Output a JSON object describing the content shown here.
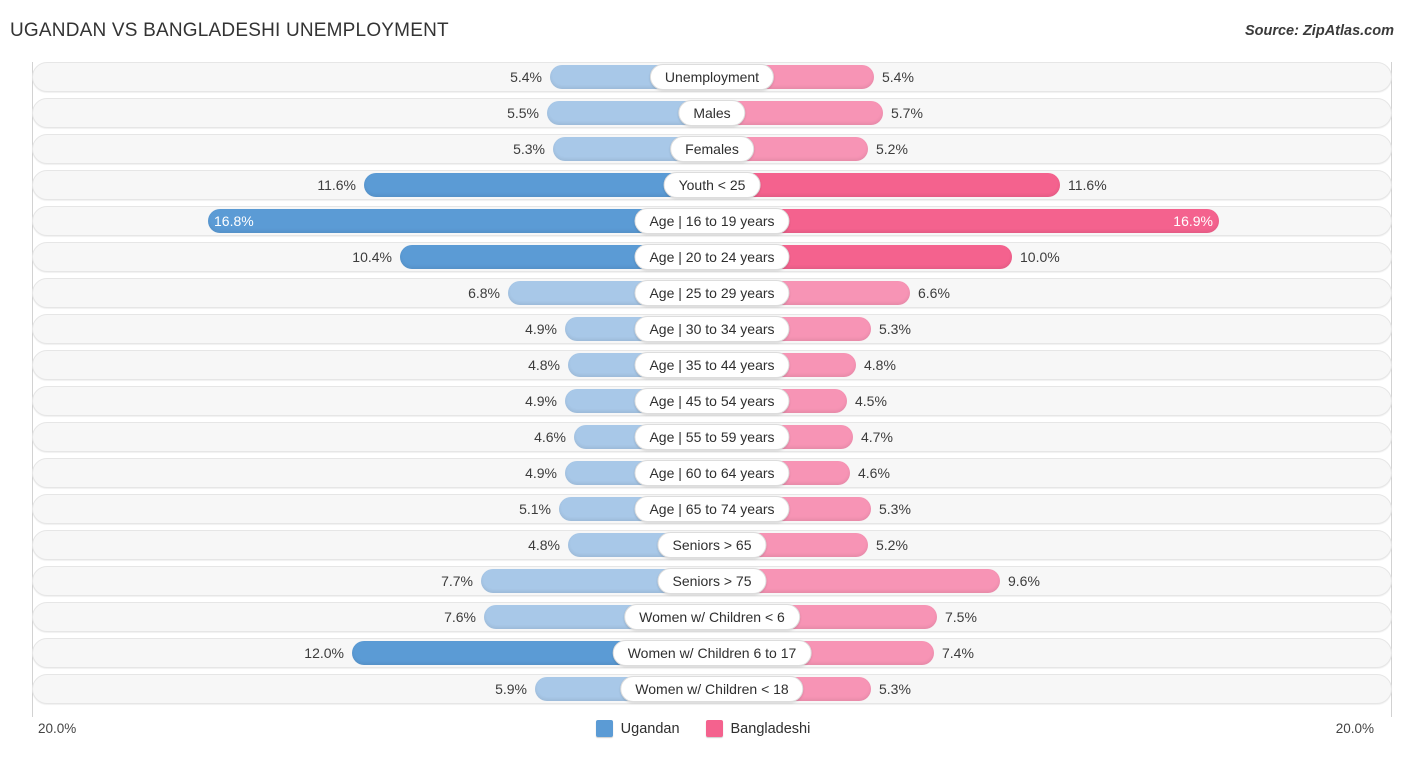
{
  "header": {
    "title": "UGANDAN VS BANGLADESHI UNEMPLOYMENT",
    "source": "Source: ZipAtlas.com"
  },
  "footer": {
    "axis_min_label": "20.0%",
    "axis_max_label": "20.0%",
    "legend": [
      {
        "label": "Ugandan",
        "color": "#5b9bd5"
      },
      {
        "label": "Bangladeshi",
        "color": "#f4628e"
      }
    ]
  },
  "colors": {
    "left_normal": "#a8c8e8",
    "left_highlight": "#5b9bd5",
    "right_normal": "#f794b5",
    "right_highlight": "#f4628e",
    "track": "#f7f7f7",
    "axis": "#d2d2d2"
  },
  "chart_data": {
    "type": "bar",
    "title": "UGANDAN VS BANGLADESHI UNEMPLOYMENT",
    "subtitle": "Source: ZipAtlas.com",
    "orientation": "horizontal-diverging",
    "xlabel": "",
    "ylabel": "",
    "axis_max": 20.0,
    "axis_unit": "%",
    "xlim": [
      20.0,
      20.0
    ],
    "grid": false,
    "legend_position": "bottom-center",
    "categories": [
      "Unemployment",
      "Males",
      "Females",
      "Youth < 25",
      "Age | 16 to 19 years",
      "Age | 20 to 24 years",
      "Age | 25 to 29 years",
      "Age | 30 to 34 years",
      "Age | 35 to 44 years",
      "Age | 45 to 54 years",
      "Age | 55 to 59 years",
      "Age | 60 to 64 years",
      "Age | 65 to 74 years",
      "Seniors > 65",
      "Seniors > 75",
      "Women w/ Children < 6",
      "Women w/ Children 6 to 17",
      "Women w/ Children < 18"
    ],
    "series": [
      {
        "name": "Ugandan",
        "color": "#5b9bd5",
        "values": [
          5.4,
          5.5,
          5.3,
          11.6,
          16.8,
          10.4,
          6.8,
          4.9,
          4.8,
          4.9,
          4.6,
          4.9,
          5.1,
          4.8,
          7.7,
          7.6,
          12.0,
          5.9
        ],
        "labels": [
          "5.4%",
          "5.5%",
          "5.3%",
          "11.6%",
          "16.8%",
          "10.4%",
          "6.8%",
          "4.9%",
          "4.8%",
          "4.9%",
          "4.6%",
          "4.9%",
          "5.1%",
          "4.8%",
          "7.7%",
          "7.6%",
          "12.0%",
          "5.9%"
        ]
      },
      {
        "name": "Bangladeshi",
        "color": "#f4628e",
        "values": [
          5.4,
          5.7,
          5.2,
          11.6,
          16.9,
          10.0,
          6.6,
          5.3,
          4.8,
          4.5,
          4.7,
          4.6,
          5.3,
          5.2,
          9.6,
          7.5,
          7.4,
          5.3
        ],
        "labels": [
          "5.4%",
          "5.7%",
          "5.2%",
          "11.6%",
          "16.9%",
          "10.0%",
          "6.6%",
          "5.3%",
          "4.8%",
          "4.5%",
          "4.7%",
          "4.6%",
          "5.3%",
          "5.2%",
          "9.6%",
          "7.5%",
          "7.4%",
          "5.3%"
        ]
      }
    ]
  },
  "rows": [
    {
      "label": "Unemployment",
      "left": 5.4,
      "left_label": "5.4%",
      "right": 5.4,
      "right_label": "5.4%",
      "left_hl": false,
      "right_hl": false
    },
    {
      "label": "Males",
      "left": 5.5,
      "left_label": "5.5%",
      "right": 5.7,
      "right_label": "5.7%",
      "left_hl": false,
      "right_hl": false
    },
    {
      "label": "Females",
      "left": 5.3,
      "left_label": "5.3%",
      "right": 5.2,
      "right_label": "5.2%",
      "left_hl": false,
      "right_hl": false
    },
    {
      "label": "Youth < 25",
      "left": 11.6,
      "left_label": "11.6%",
      "right": 11.6,
      "right_label": "11.6%",
      "left_hl": true,
      "right_hl": true
    },
    {
      "label": "Age | 16 to 19 years",
      "left": 16.8,
      "left_label": "16.8%",
      "right": 16.9,
      "right_label": "16.9%",
      "left_hl": true,
      "right_hl": true
    },
    {
      "label": "Age | 20 to 24 years",
      "left": 10.4,
      "left_label": "10.4%",
      "right": 10.0,
      "right_label": "10.0%",
      "left_hl": true,
      "right_hl": true
    },
    {
      "label": "Age | 25 to 29 years",
      "left": 6.8,
      "left_label": "6.8%",
      "right": 6.6,
      "right_label": "6.6%",
      "left_hl": false,
      "right_hl": false
    },
    {
      "label": "Age | 30 to 34 years",
      "left": 4.9,
      "left_label": "4.9%",
      "right": 5.3,
      "right_label": "5.3%",
      "left_hl": false,
      "right_hl": false
    },
    {
      "label": "Age | 35 to 44 years",
      "left": 4.8,
      "left_label": "4.8%",
      "right": 4.8,
      "right_label": "4.8%",
      "left_hl": false,
      "right_hl": false
    },
    {
      "label": "Age | 45 to 54 years",
      "left": 4.9,
      "left_label": "4.9%",
      "right": 4.5,
      "right_label": "4.5%",
      "left_hl": false,
      "right_hl": false
    },
    {
      "label": "Age | 55 to 59 years",
      "left": 4.6,
      "left_label": "4.6%",
      "right": 4.7,
      "right_label": "4.7%",
      "left_hl": false,
      "right_hl": false
    },
    {
      "label": "Age | 60 to 64 years",
      "left": 4.9,
      "left_label": "4.9%",
      "right": 4.6,
      "right_label": "4.6%",
      "left_hl": false,
      "right_hl": false
    },
    {
      "label": "Age | 65 to 74 years",
      "left": 5.1,
      "left_label": "5.1%",
      "right": 5.3,
      "right_label": "5.3%",
      "left_hl": false,
      "right_hl": false
    },
    {
      "label": "Seniors > 65",
      "left": 4.8,
      "left_label": "4.8%",
      "right": 5.2,
      "right_label": "5.2%",
      "left_hl": false,
      "right_hl": false
    },
    {
      "label": "Seniors > 75",
      "left": 7.7,
      "left_label": "7.7%",
      "right": 9.6,
      "right_label": "9.6%",
      "left_hl": false,
      "right_hl": false
    },
    {
      "label": "Women w/ Children < 6",
      "left": 7.6,
      "left_label": "7.6%",
      "right": 7.5,
      "right_label": "7.5%",
      "left_hl": false,
      "right_hl": false
    },
    {
      "label": "Women w/ Children 6 to 17",
      "left": 12.0,
      "left_label": "12.0%",
      "right": 7.4,
      "right_label": "7.4%",
      "left_hl": true,
      "right_hl": false
    },
    {
      "label": "Women w/ Children < 18",
      "left": 5.9,
      "left_label": "5.9%",
      "right": 5.3,
      "right_label": "5.3%",
      "left_hl": false,
      "right_hl": false
    }
  ]
}
